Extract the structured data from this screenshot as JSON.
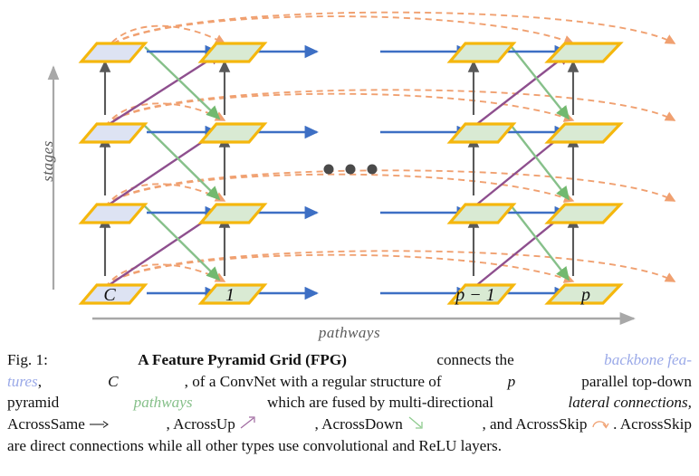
{
  "figure": {
    "axis_y_label": "stages",
    "axis_x_label": "pathways",
    "ellipsis": "•••",
    "colors": {
      "node_border": "#f5b70d",
      "backbone_fill": "#dde3f3",
      "pyramid_fill": "#d9ead3",
      "across_same": "#3d6fc4",
      "across_up": "#8e4f8e",
      "across_down": "#86c08a",
      "across_skip": "#f0a070",
      "stage_arrow": "#595959",
      "axis_gray": "#9a9a9a"
    },
    "columns": [
      {
        "id": "c",
        "label": "C",
        "fill": "backbone"
      },
      {
        "id": "1",
        "label": "1",
        "fill": "pyramid"
      },
      {
        "id": "pm1",
        "label": "p − 1",
        "fill": "pyramid"
      },
      {
        "id": "p",
        "label": "p",
        "fill": "pyramid"
      }
    ],
    "stage_count": 4,
    "node_labels_bottom_row": [
      "C",
      "1",
      "p − 1",
      "p"
    ]
  },
  "caption": {
    "figure_number": "Fig. 1:",
    "title": "A Feature Pyramid Grid (FPG)",
    "l1_a": "connects the",
    "l1_backbone": "backbone fea-",
    "l2_backbone": "tures",
    "l2_a": ",",
    "l2_C": "C",
    "l2_b": ", of a ConvNet with a regular structure of",
    "l2_p": "p",
    "l2_c": "parallel top-down",
    "l3_a": "pyramid",
    "l3_pathways": "pathways",
    "l3_b": "which are fused by multi-directional",
    "l3_lateral": "lateral connections,",
    "l4_same": "AcrossSame",
    "l4_same_arrow": "→",
    "l4_up": ", AcrossUp",
    "l4_up_arrow": "↗",
    "l4_down": ", AcrossDown",
    "l4_down_arrow": "↘",
    "l4_skip": ", and AcrossSkip",
    "l4_skip_arrow": "↷",
    "l4_end": ". AcrossSkip",
    "l5": "are direct connections while all other types use convolutional and ReLU layers."
  }
}
